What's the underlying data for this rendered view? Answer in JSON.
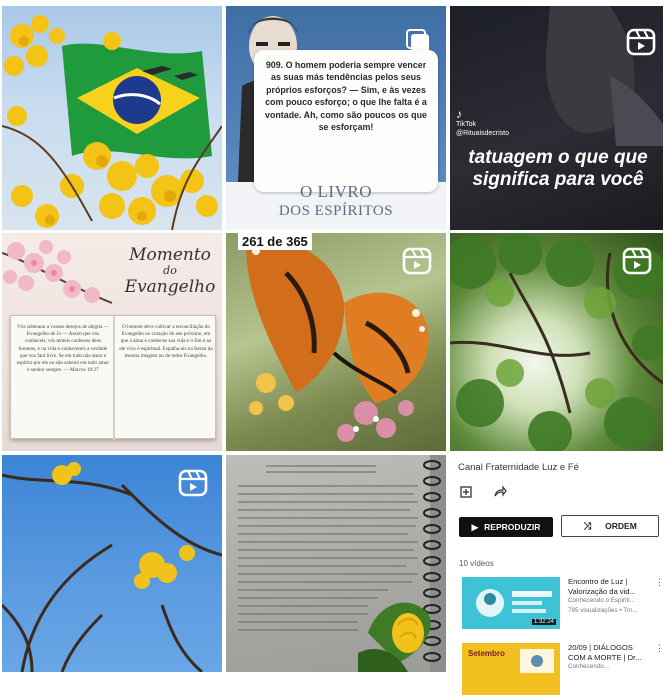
{
  "colors": {
    "panel_button_dark": "#111111",
    "thumb1_bg": "#3ec2d6",
    "thumb2_bg": "#f2c020"
  },
  "tiles": {
    "t2": {
      "quote": "909. O homem poderia sempre vencer as suas más tendências pelos seus próprios esforços? — Sim, e às vezes com pouco esforço; o que lhe falta é a vontade. Ah, como são poucos os que se esforçam!",
      "book_line1": "O LIVRO",
      "book_line2": "DOS ESPÍRITOS"
    },
    "t3": {
      "tiktok_label": "TikTok",
      "tiktok_handle": "@Rituaisdecristo",
      "caption": "tatuagem o que que significa para você"
    },
    "t4": {
      "script_line1": "Momento",
      "script_line2": "do",
      "script_line3": "Evangelho",
      "page_left": "Vós soberano a vossos desejos de alegria — Evangelho de Jo — Assim que vós conheceis, vós tenteis conheces deus homens, e na vida e conhecereis a verdade que vos fará livre. Se em tudo não amar e espírito por ele eu não saberei em todo amor e senhor sempre. — Marcos 10:27",
      "page_right": "O homem deve cultivar a reconciliação do Evangelho no coração do seu próximo, em que a alma e conheces sua vida e o fim e ao ele vivo é espiritual. Espalha-ais na forma da mesma imagem no de todos Evangelho."
    },
    "t5": {
      "counter": "261 de 365"
    }
  },
  "panel": {
    "channel_name": "Canal Fraternidade Luz e Fé",
    "play_label": "REPRODUZIR",
    "order_label": "ORDEM",
    "video_count": "10 vídeos",
    "videos": [
      {
        "title": "Encontro de Luz | Valorização da vid...",
        "channel": "Conhecendo o Espiriti...",
        "stats": "785 visualizações • Trn...",
        "duration": "1:32:24"
      },
      {
        "title": "20/09 | DIÁLOGOS COM A MORTE | Dr...",
        "channel": "",
        "stats": "Conhecendo...",
        "thumb_label": "Setembro"
      }
    ]
  }
}
